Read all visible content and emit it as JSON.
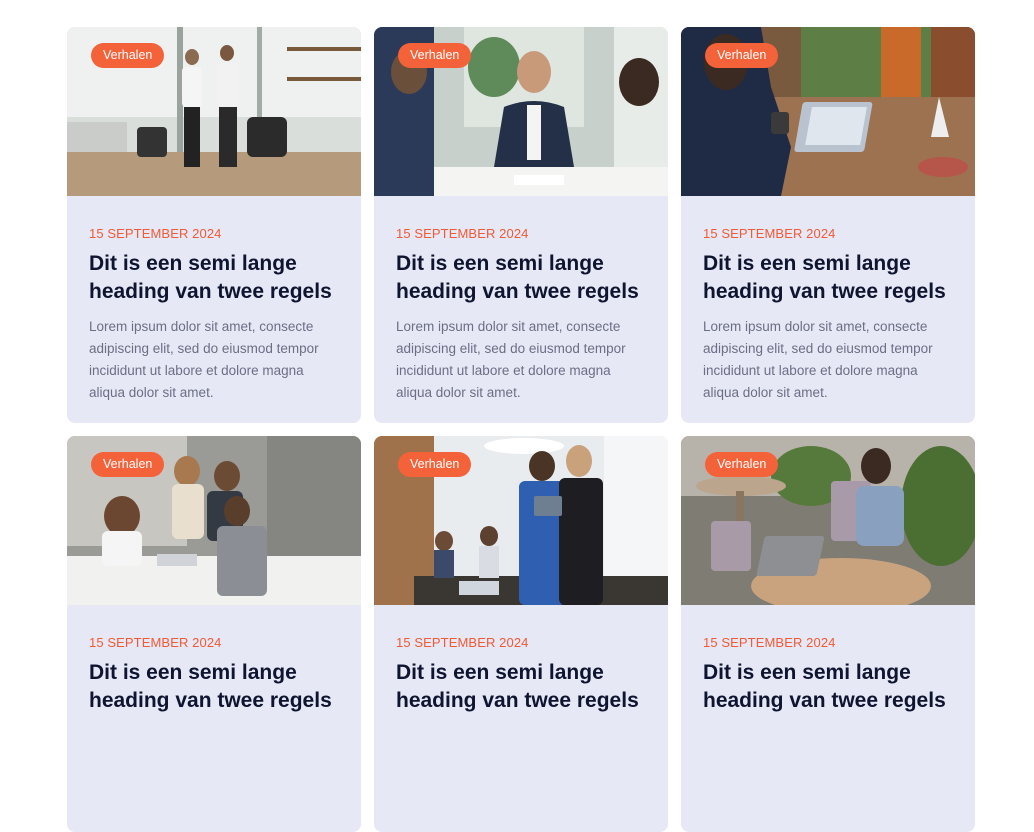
{
  "cards": [
    {
      "badge": "Verhalen",
      "date": "15 SEPTEMBER 2024",
      "title": "Dit is een semi lange heading van twee regels",
      "excerpt": "Lorem ipsum dolor sit amet, consecte adipiscing elit, sed do eiusmod tempor incididunt ut labore et dolore magna aliqua dolor sit amet.",
      "image": "office-walking-photo"
    },
    {
      "badge": "Verhalen",
      "date": "15 SEPTEMBER 2024",
      "title": "Dit is een semi lange heading van twee regels",
      "excerpt": "Lorem ipsum dolor sit amet, consecte adipiscing elit, sed do eiusmod tempor incididunt ut labore et dolore magna aliqua dolor sit amet.",
      "image": "meeting-smile-photo"
    },
    {
      "badge": "Verhalen",
      "date": "15 SEPTEMBER 2024",
      "title": "Dit is een semi lange heading van twee regels",
      "excerpt": "Lorem ipsum dolor sit amet, consecte adipiscing elit, sed do eiusmod tempor incididunt ut labore et dolore magna aliqua dolor sit amet.",
      "image": "laptop-desk-photo"
    },
    {
      "badge": "Verhalen",
      "date": "15 SEPTEMBER 2024",
      "title": "Dit is een semi lange heading van twee regels",
      "excerpt": "",
      "image": "team-table-photo"
    },
    {
      "badge": "Verhalen",
      "date": "15 SEPTEMBER 2024",
      "title": "Dit is een semi lange heading van twee regels",
      "excerpt": "",
      "image": "tablet-conference-photo"
    },
    {
      "badge": "Verhalen",
      "date": "15 SEPTEMBER 2024",
      "title": "Dit is een semi lange heading van twee regels",
      "excerpt": "",
      "image": "cafe-laptop-photo"
    }
  ],
  "colors": {
    "accent": "#f4623a",
    "card_bg": "#e6e8f5",
    "heading": "#0f1530",
    "body_text": "#6b6f85"
  }
}
